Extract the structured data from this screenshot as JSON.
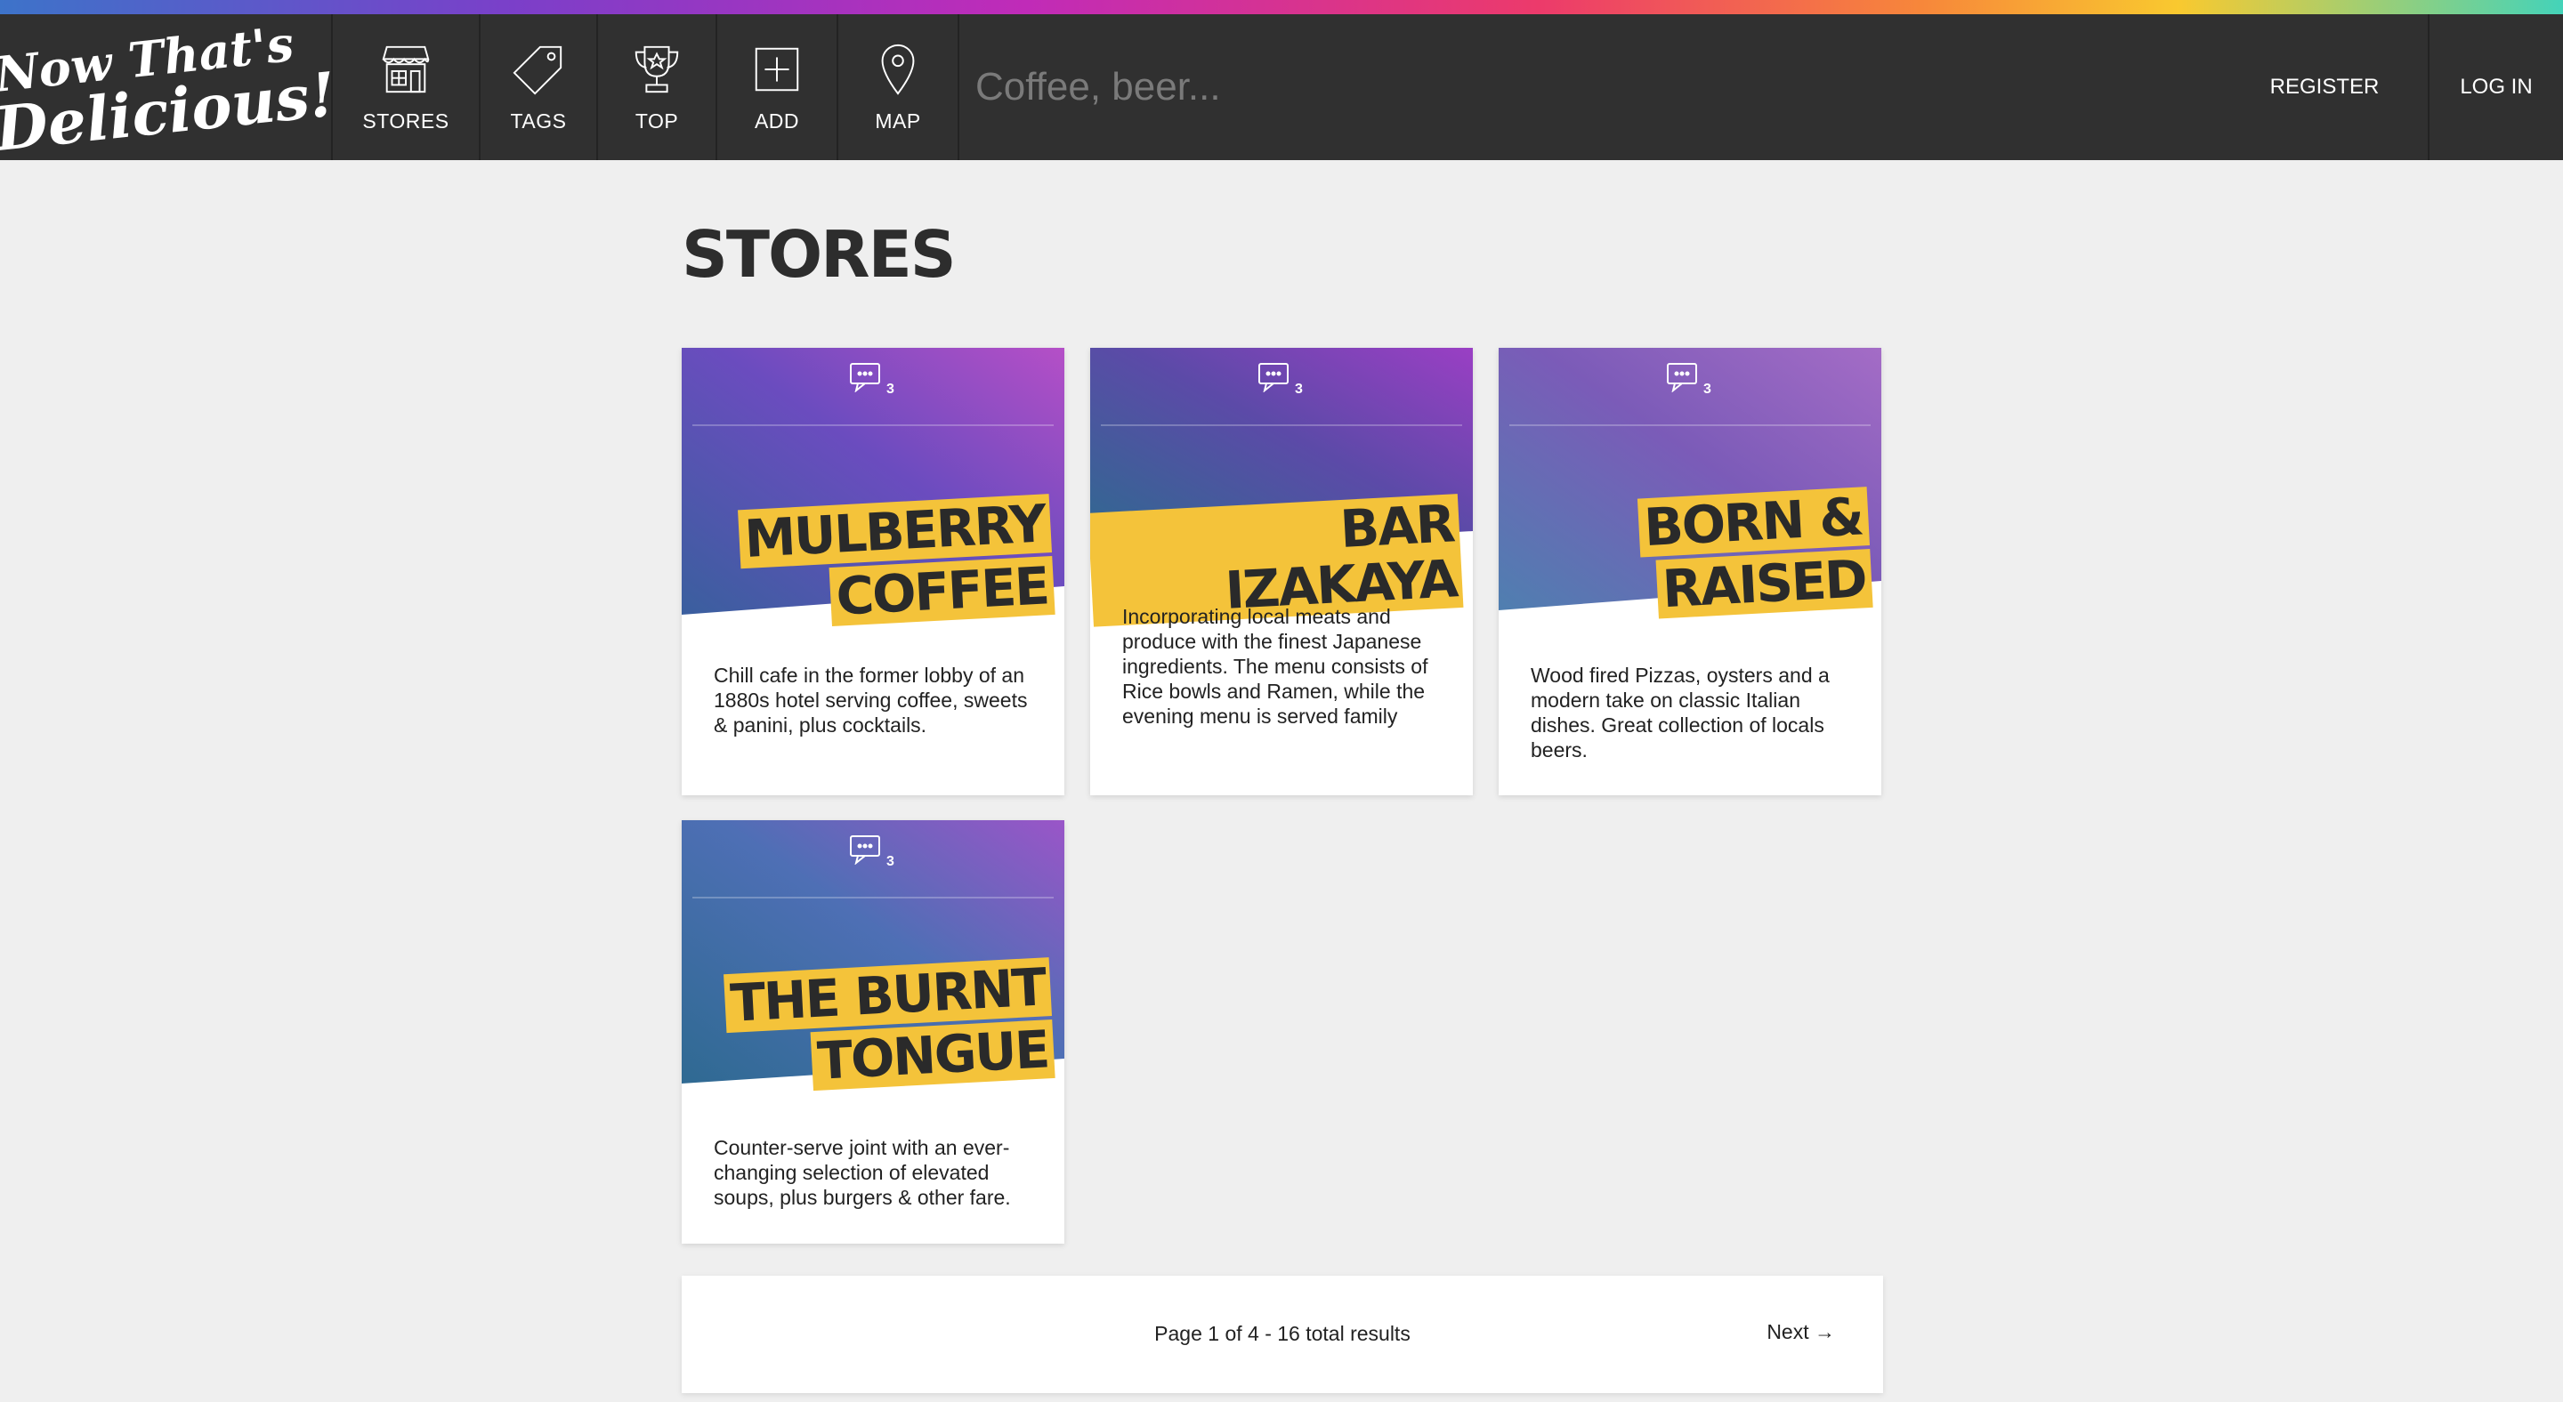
{
  "logo": {
    "line1": "Now That's",
    "line2": "Delicious!"
  },
  "nav": [
    {
      "label": "STORES",
      "icon": "store-icon"
    },
    {
      "label": "TAGS",
      "icon": "tag-icon"
    },
    {
      "label": "TOP",
      "icon": "trophy-icon"
    },
    {
      "label": "ADD",
      "icon": "add-icon"
    },
    {
      "label": "MAP",
      "icon": "map-pin-icon"
    }
  ],
  "search": {
    "placeholder": "Coffee, beer...",
    "value": ""
  },
  "auth": {
    "register": "REGISTER",
    "login": "LOG IN"
  },
  "page": {
    "title": "STORES"
  },
  "stores": [
    {
      "title_lines": [
        "MULBERRY",
        "COFFEE"
      ],
      "comments": "3",
      "description": "Chill cafe in the former lobby of an 1880s hotel serving coffee, sweets & panini, plus cocktails.",
      "colors": [
        "#3a5f9e",
        "#6b4cbf",
        "#b54fc7"
      ]
    },
    {
      "title_lines": [
        "BAR IZAKAYA"
      ],
      "comments": "3",
      "description": "Incorporating local meats and produce with the finest Japanese ingredients. The menu consists of Rice bowls and Ramen, while the evening menu is served family",
      "colors": [
        "#2d6b8f",
        "#5c4aa8",
        "#9a3fc4"
      ]
    },
    {
      "title_lines": [
        "BORN &",
        "RAISED"
      ],
      "comments": "3",
      "description": "Wood fired Pizzas, oysters and a modern take on classic Italian dishes. Great collection of locals beers.",
      "colors": [
        "#4f7fb0",
        "#7b5bb8",
        "#a46cc6"
      ]
    },
    {
      "title_lines": [
        "THE BURNT",
        "TONGUE"
      ],
      "comments": "3",
      "description": "Counter-serve joint with an ever-changing selection of elevated soups, plus burgers & other fare.",
      "colors": [
        "#2f6a92",
        "#4e6fb5",
        "#9a55c8"
      ]
    }
  ],
  "pagination": {
    "info": "Page 1 of 4 - 16 total results",
    "next": "Next →"
  }
}
